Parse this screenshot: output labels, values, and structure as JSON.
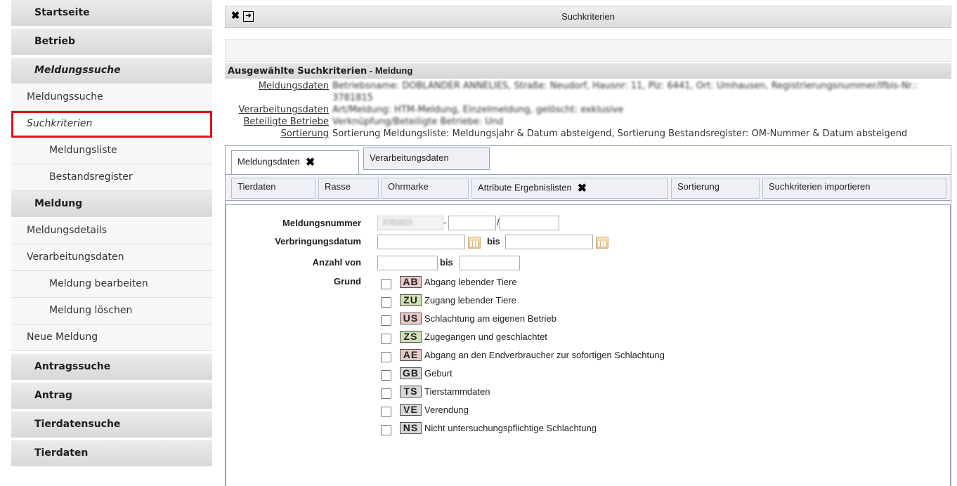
{
  "sidebar": {
    "items": [
      {
        "label": "Startseite"
      },
      {
        "label": "Betrieb"
      },
      {
        "label": "Meldungssuche"
      },
      {
        "label": "Meldungssuche"
      },
      {
        "label": "Suchkriterien"
      },
      {
        "label": "Meldungsliste"
      },
      {
        "label": "Bestandsregister"
      },
      {
        "label": "Meldung"
      },
      {
        "label": "Meldungsdetails"
      },
      {
        "label": "Verarbeitungsdaten"
      },
      {
        "label": "Meldung bearbeiten"
      },
      {
        "label": "Meldung löschen"
      },
      {
        "label": "Neue Meldung"
      },
      {
        "label": "Antragssuche"
      },
      {
        "label": "Antrag"
      },
      {
        "label": "Tierdatensuche"
      },
      {
        "label": "Tierdaten"
      }
    ]
  },
  "titlebar": {
    "title": "Suchkriterien"
  },
  "selected": {
    "heading": "Ausgewählte Suchkriterien",
    "heading_sub": " - Meldung",
    "rows": [
      {
        "key": "Meldungsdaten",
        "value": "Betriebsname: DOBLANDER ANNELIES, Straße: Neudorf, Hausnr: 11, Plz: 6441, Ort: Umhausen, Registrierungsnummer/lfbis-Nr.: 3781815",
        "blurred": true
      },
      {
        "key": "Verarbeitungsdaten",
        "value": "Art/Meldung: HTM-Meldung, Einzelmeldung, gelöscht: exklusive",
        "blurred": true
      },
      {
        "key": "Beteiligte Betriebe",
        "value": "Verknüpfung/Beteiligte Betriebe: Und",
        "blurred": true
      },
      {
        "key": "Sortierung",
        "value": "Sortierung Meldungsliste: Meldungsjahr & Datum absteigend, Sortierung Bestandsregister: OM-Nummer & Datum absteigend",
        "blurred": false
      }
    ]
  },
  "tabs1": [
    "Meldungsdaten",
    "Verarbeitungsdaten"
  ],
  "tabs2": [
    "Tierdaten",
    "Rasse",
    "Ohrmarke",
    "Attribute Ergebnislisten",
    "Sortierung",
    "Suchkriterien importieren"
  ],
  "form": {
    "meldungsnummer_label": "Meldungsnummer",
    "meldungsnummer_prefix": "3781815",
    "dash": "-",
    "slash": "/",
    "verbringungsdatum_label": "Verbringungsdatum",
    "anzahl_label": "Anzahl von",
    "bis": "bis",
    "grund_label": "Grund",
    "reasons": [
      {
        "code": "AB",
        "label": "Abgang lebender Tiere",
        "color": "#e8c8c8"
      },
      {
        "code": "ZU",
        "label": "Zugang lebender Tiere",
        "color": "#cfe0b4"
      },
      {
        "code": "US",
        "label": "Schlachtung am eigenen Betrieb",
        "color": "#e8c8c8"
      },
      {
        "code": "ZS",
        "label": "Zugegangen und geschlachtet",
        "color": "#cfe0b4"
      },
      {
        "code": "AE",
        "label": "Abgang an den Endverbraucher zur sofortigen Schlachtung",
        "color": "#e8c8c8"
      },
      {
        "code": "GB",
        "label": "Geburt",
        "color": "#d8d8d8"
      },
      {
        "code": "TS",
        "label": "Tierstammdaten",
        "color": "#d8d8d8"
      },
      {
        "code": "VE",
        "label": "Verendung",
        "color": "#d8d8d8"
      },
      {
        "code": "NS",
        "label": "Nicht untersuchungspflichtige Schlachtung",
        "color": "#d8d8d8"
      }
    ]
  }
}
